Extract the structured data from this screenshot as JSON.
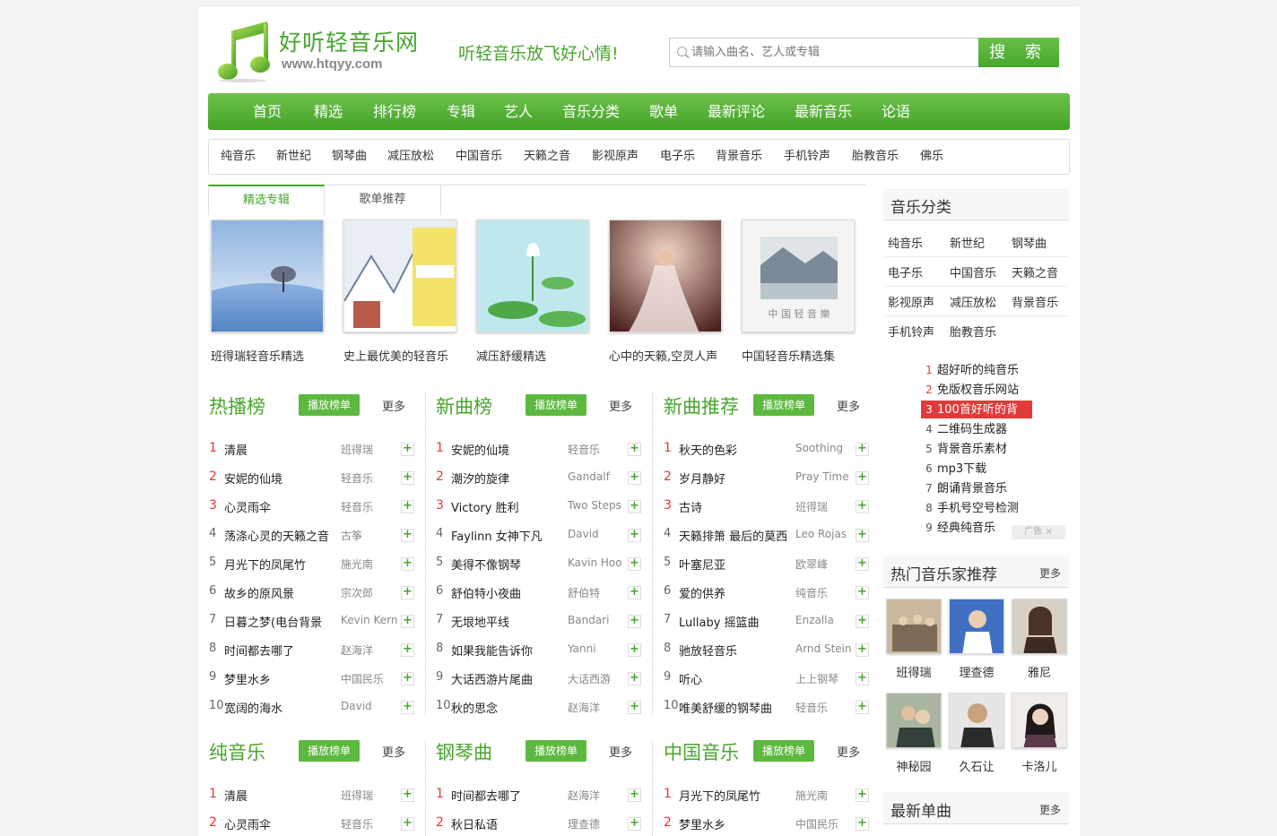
{
  "header": {
    "site_name": "好听轻音乐网",
    "site_url": "www.htqyy.com",
    "slogan": "听轻音乐放飞好心情!",
    "search_placeholder": "请输入曲名、艺人或专辑",
    "search_button": "搜 索"
  },
  "nav": [
    "首页",
    "精选",
    "排行榜",
    "专辑",
    "艺人",
    "音乐分类",
    "歌单",
    "最新评论",
    "最新音乐",
    "论语"
  ],
  "subnav": [
    "纯音乐",
    "新世纪",
    "钢琴曲",
    "减压放松",
    "中国音乐",
    "天籁之音",
    "影视原声",
    "电子乐",
    "背景音乐",
    "手机铃声",
    "胎教音乐",
    "佛乐"
  ],
  "tabs": [
    "精选专辑",
    "歌单推荐"
  ],
  "albums": [
    "班得瑞轻音乐精选",
    "史上最优美的轻音乐",
    "减压舒缓精选",
    "心中的天籁,空灵人声",
    "中国轻音乐精选集"
  ],
  "chart_labels": {
    "play": "播放榜单",
    "more": "更多"
  },
  "charts": [
    {
      "title": "热播榜",
      "rows": [
        {
          "n": "1",
          "song": "清晨",
          "artist": "班得瑞"
        },
        {
          "n": "2",
          "song": "安妮的仙境",
          "artist": "轻音乐"
        },
        {
          "n": "3",
          "song": "心灵雨伞",
          "artist": "轻音乐"
        },
        {
          "n": "4",
          "song": "荡涤心灵的天籁之音",
          "artist": "古筝"
        },
        {
          "n": "5",
          "song": "月光下的凤尾竹",
          "artist": "施光南"
        },
        {
          "n": "6",
          "song": "故乡的原风景",
          "artist": "宗次郎"
        },
        {
          "n": "7",
          "song": "日暮之梦(电台背景",
          "artist": "Kevin Kern"
        },
        {
          "n": "8",
          "song": "时间都去哪了",
          "artist": "赵海洋"
        },
        {
          "n": "9",
          "song": "梦里水乡",
          "artist": "中国民乐"
        },
        {
          "n": "10",
          "song": "宽阔的海水",
          "artist": "David"
        }
      ]
    },
    {
      "title": "新曲榜",
      "rows": [
        {
          "n": "1",
          "song": "安妮的仙境",
          "artist": "轻音乐"
        },
        {
          "n": "2",
          "song": "潮汐的旋律",
          "artist": "Gandalf"
        },
        {
          "n": "3",
          "song": "Victory 胜利",
          "artist": "Two Steps"
        },
        {
          "n": "4",
          "song": "Faylinn 女神下凡",
          "artist": "David"
        },
        {
          "n": "5",
          "song": "美得不像钢琴",
          "artist": "Kavin Hoo"
        },
        {
          "n": "6",
          "song": "舒伯特小夜曲",
          "artist": "舒伯特"
        },
        {
          "n": "7",
          "song": "无垠地平线",
          "artist": "Bandari"
        },
        {
          "n": "8",
          "song": "如果我能告诉你",
          "artist": "Yanni"
        },
        {
          "n": "9",
          "song": "大话西游片尾曲",
          "artist": "大话西游"
        },
        {
          "n": "10",
          "song": "秋的思念",
          "artist": "赵海洋"
        }
      ]
    },
    {
      "title": "新曲推荐",
      "rows": [
        {
          "n": "1",
          "song": "秋天的色彩",
          "artist": "Soothing"
        },
        {
          "n": "2",
          "song": "岁月静好",
          "artist": "Pray Time"
        },
        {
          "n": "3",
          "song": "古诗",
          "artist": "班得瑞"
        },
        {
          "n": "4",
          "song": "天籁排箫 最后的莫西",
          "artist": "Leo Rojas"
        },
        {
          "n": "5",
          "song": "叶塞尼亚",
          "artist": "欧翠峰"
        },
        {
          "n": "6",
          "song": "爱的供养",
          "artist": "纯音乐"
        },
        {
          "n": "7",
          "song": "Lullaby 摇篮曲",
          "artist": "Enzalla"
        },
        {
          "n": "8",
          "song": "驰放轻音乐",
          "artist": "Arnd Stein"
        },
        {
          "n": "9",
          "song": "听心",
          "artist": "上上钢琴"
        },
        {
          "n": "10",
          "song": "唯美舒缓的钢琴曲",
          "artist": "轻音乐"
        }
      ]
    },
    {
      "title": "纯音乐",
      "rows": [
        {
          "n": "1",
          "song": "清晨",
          "artist": "班得瑞"
        },
        {
          "n": "2",
          "song": "心灵雨伞",
          "artist": "轻音乐"
        }
      ]
    },
    {
      "title": "钢琴曲",
      "rows": [
        {
          "n": "1",
          "song": "时间都去哪了",
          "artist": "赵海洋"
        },
        {
          "n": "2",
          "song": "秋日私语",
          "artist": "理查德"
        }
      ]
    },
    {
      "title": "中国音乐",
      "rows": [
        {
          "n": "1",
          "song": "月光下的凤尾竹",
          "artist": "施光南"
        },
        {
          "n": "2",
          "song": "梦里水乡",
          "artist": "中国民乐"
        }
      ]
    }
  ],
  "sidebar": {
    "categories_title": "音乐分类",
    "categories": [
      "纯音乐",
      "新世纪",
      "钢琴曲",
      "电子乐",
      "中国音乐",
      "天籁之音",
      "影视原声",
      "减压放松",
      "背景音乐",
      "手机铃声",
      "胎教音乐"
    ],
    "ads": [
      {
        "n": "1",
        "text": "超好听的纯音乐"
      },
      {
        "n": "2",
        "text": "免版权音乐网站"
      },
      {
        "n": "3",
        "text": "100首好听的背"
      },
      {
        "n": "4",
        "text": "二维码生成器"
      },
      {
        "n": "5",
        "text": "背景音乐素材"
      },
      {
        "n": "6",
        "text": "mp3下载"
      },
      {
        "n": "7",
        "text": "朗诵背景音乐"
      },
      {
        "n": "8",
        "text": "手机号空号检测"
      },
      {
        "n": "9",
        "text": "经典纯音乐"
      }
    ],
    "ad_label": "广告 ×",
    "musicians_title": "热门音乐家推荐",
    "musicians_more": "更多",
    "musicians": [
      "班得瑞",
      "理查德",
      "雅尼",
      "神秘园",
      "久石让",
      "卡洛儿"
    ],
    "singles_title": "最新单曲",
    "singles_more": "更多"
  },
  "colors": {
    "brand_green": "#47a62c",
    "hot_red": "#e03b3b"
  }
}
